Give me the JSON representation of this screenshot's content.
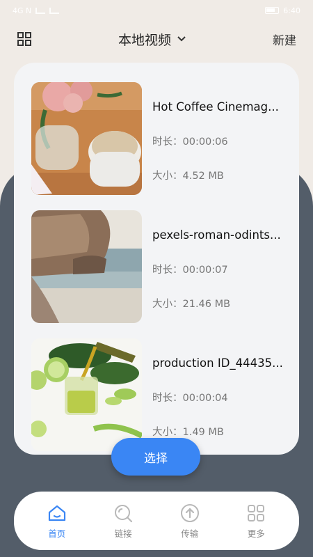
{
  "status": {
    "left": "4G N",
    "time": "6:40"
  },
  "header": {
    "title": "本地视频",
    "new_label": "新建"
  },
  "videos": [
    {
      "name": "Hot Coffee Cinemag...",
      "duration": "时长：00:00:06",
      "size": "大小：4.52 MB",
      "thumb": "coffee-and-flowers"
    },
    {
      "name": "pexels-roman-odints...",
      "duration": "时长：00:00:07",
      "size": "大小：21.46 MB",
      "thumb": "beach-cliff"
    },
    {
      "name": "production ID_44435...",
      "duration": "时长：00:00:04",
      "size": "大小：1.49 MB",
      "thumb": "green-juice"
    }
  ],
  "select_label": "选择",
  "tabs": [
    {
      "label": "首页",
      "icon": "home-icon",
      "active": true
    },
    {
      "label": "链接",
      "icon": "search-link-icon",
      "active": false
    },
    {
      "label": "传输",
      "icon": "upload-icon",
      "active": false
    },
    {
      "label": "更多",
      "icon": "more-grid-icon",
      "active": false
    }
  ],
  "colors": {
    "accent": "#3a86f4",
    "dark_bg": "#535d69",
    "light_bg": "#f0ebe6",
    "card": "#f3f4f6"
  }
}
